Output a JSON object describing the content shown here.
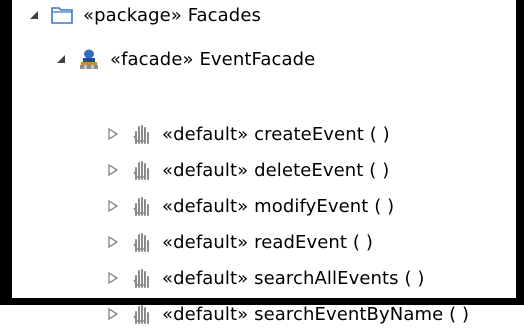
{
  "tree": {
    "package": {
      "stereotype": "«package»",
      "name": "Facades",
      "icon": "package-folder-icon"
    },
    "facade": {
      "stereotype": "«facade»",
      "name": "EventFacade",
      "icon": "facade-class-icon"
    },
    "operations": [
      {
        "stereotype": "«default»",
        "name": "createEvent ( )",
        "icon": "operation-icon"
      },
      {
        "stereotype": "«default»",
        "name": "deleteEvent ( )",
        "icon": "operation-icon"
      },
      {
        "stereotype": "«default»",
        "name": "modifyEvent ( )",
        "icon": "operation-icon"
      },
      {
        "stereotype": "«default»",
        "name": "readEvent ( )",
        "icon": "operation-icon"
      },
      {
        "stereotype": "«default»",
        "name": "searchAllEvents ( )",
        "icon": "operation-icon"
      },
      {
        "stereotype": "«default»",
        "name": "searchEventByName ( )",
        "icon": "operation-icon"
      }
    ]
  },
  "colors": {
    "frame": "#000000",
    "folder": "#3b78c4",
    "triangle": "#404040",
    "operation": "#8a8a8a"
  }
}
